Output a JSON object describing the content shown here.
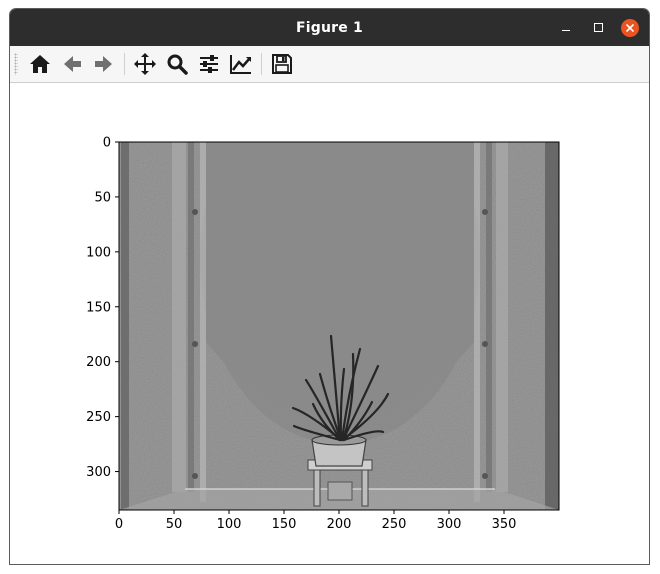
{
  "window": {
    "title": "Figure 1"
  },
  "toolbar": {
    "buttons": [
      {
        "icon": "home-icon",
        "label": "Home"
      },
      {
        "icon": "back-arrow-icon",
        "label": "Back"
      },
      {
        "icon": "forward-arrow-icon",
        "label": "Forward"
      },
      {
        "icon": "pan-icon",
        "label": "Pan"
      },
      {
        "icon": "zoom-icon",
        "label": "Zoom"
      },
      {
        "icon": "subplots-icon",
        "label": "Configure subplots"
      },
      {
        "icon": "edit-curves-icon",
        "label": "Edit axis"
      },
      {
        "icon": "save-icon",
        "label": "Save"
      }
    ]
  },
  "colors": {
    "titlebar": "#2d2d2d",
    "close_button": "#e95420",
    "image_gray": "#8a8a8a"
  },
  "chart_data": {
    "type": "image",
    "xticks": [
      0,
      50,
      100,
      150,
      200,
      250,
      300,
      350
    ],
    "yticks": [
      0,
      50,
      100,
      150,
      200,
      250,
      300
    ],
    "xlim": [
      0,
      400
    ],
    "ylim": [
      335,
      0
    ],
    "grid": false
  }
}
